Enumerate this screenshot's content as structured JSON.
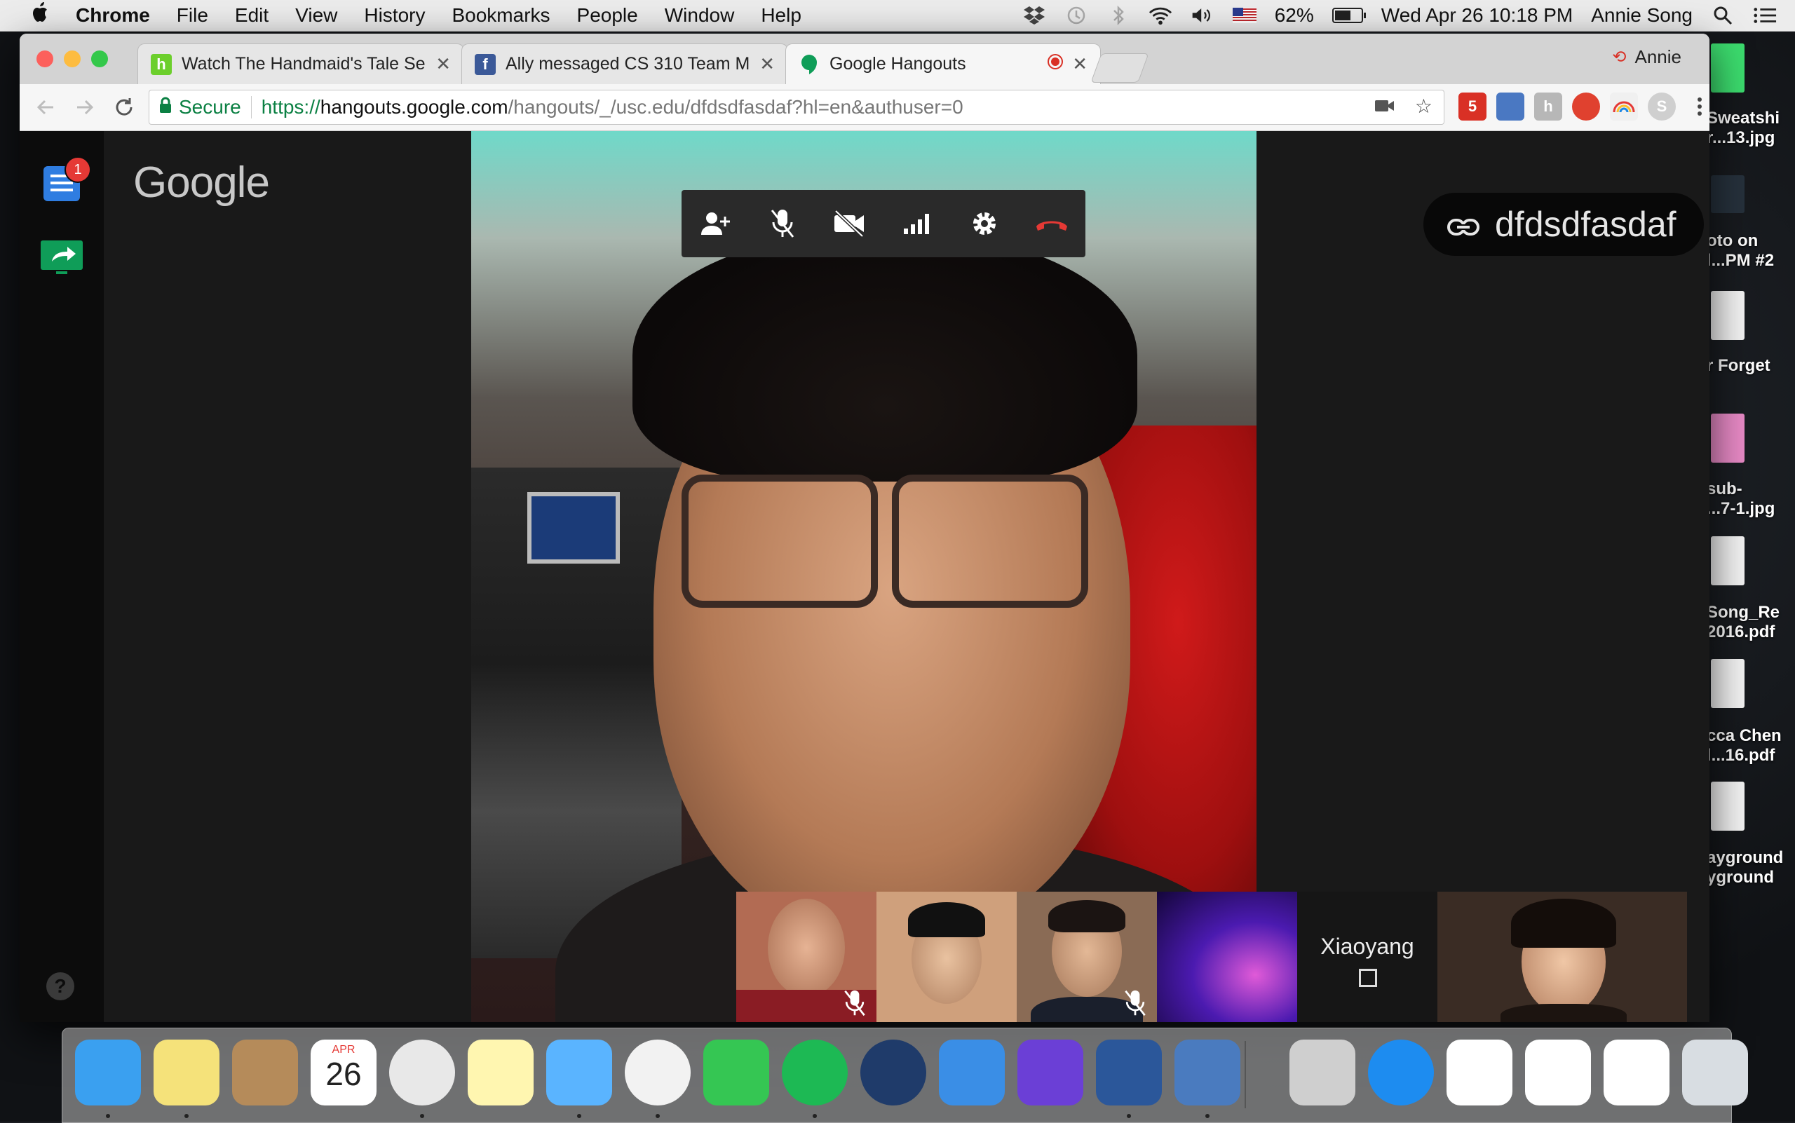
{
  "menubar": {
    "apple_label": "",
    "app_name": "Chrome",
    "menus": [
      "File",
      "Edit",
      "View",
      "History",
      "Bookmarks",
      "People",
      "Window",
      "Help"
    ],
    "battery_percent": "62%",
    "battery_level": 0.62,
    "datetime": "Wed Apr 26  10:18 PM",
    "user": "Annie Song",
    "icons": [
      "dropbox-icon",
      "time-machine-icon",
      "bluetooth-icon",
      "wifi-icon",
      "volume-icon",
      "us-flag-icon",
      "spotlight-icon",
      "notification-center-icon"
    ]
  },
  "browser": {
    "tabs": [
      {
        "title": "Watch The Handmaid's Tale Se",
        "favicon": "hulu-icon",
        "favicon_color": "#6ccf2c",
        "favicon_letter": "h",
        "active": false
      },
      {
        "title": "Ally messaged CS 310 Team M",
        "favicon": "facebook-icon",
        "favicon_color": "#3b5998",
        "favicon_letter": "f",
        "active": false
      },
      {
        "title": "Google Hangouts",
        "favicon": "hangouts-icon",
        "favicon_color": "#0f9d58",
        "favicon_letter": "",
        "active": true
      }
    ],
    "profile_name": "Annie",
    "secure_label": "Secure",
    "url_scheme": "https://",
    "url_host": "hangouts.google.com",
    "url_path": "/hangouts/_/usc.edu/dfdsdfasdaf?hl=en&authuser=0",
    "extensions": [
      {
        "name": "gmail-ext-icon",
        "color": "#d93025",
        "label": "5"
      },
      {
        "name": "download-ext-icon",
        "color": "#4a78c2",
        "label": ""
      },
      {
        "name": "ext-h-icon",
        "color": "#b7b7b7",
        "label": "h"
      },
      {
        "name": "ext-red-icon",
        "color": "#e0412f",
        "label": ""
      },
      {
        "name": "rainbow-ext-icon",
        "color": "#f0f0f0",
        "label": ""
      },
      {
        "name": "skype-ext-icon",
        "color": "#cfcfcf",
        "label": "S"
      }
    ]
  },
  "hangouts": {
    "brand": "Google",
    "notification_count": "1",
    "help_label": "?",
    "meeting_name": "dfdsdfasdaf",
    "call_controls": [
      "add-person",
      "mute-mic",
      "camera-off",
      "signal",
      "settings",
      "hang-up"
    ],
    "participants": [
      {
        "name": "",
        "muted": true,
        "tone": "#b26b53"
      },
      {
        "name": "",
        "muted": false,
        "tone": "#cfa07c"
      },
      {
        "name": "",
        "muted": true,
        "tone": "#8a6b55"
      },
      {
        "name": "",
        "muted": false,
        "tone": "#5a1bd0"
      },
      {
        "name": "Xiaoyang",
        "muted": false,
        "tone": "#161616"
      },
      {
        "name": "",
        "muted": false,
        "tone": "#3a2c24"
      }
    ]
  },
  "desktop": {
    "files": [
      {
        "label1": "Sweatshi",
        "label2": "r...13.jpg",
        "thumb_color": "#3cdc6e"
      },
      {
        "label1": "oto on",
        "label2": "l...PM #2",
        "thumb_color": "#26313c"
      },
      {
        "label1": "r Forget",
        "label2": "",
        "thumb_color": "#f4f4f4"
      },
      {
        "label1": "sub-",
        "label2": "...7-1.jpg",
        "thumb_color": "#e88ac6"
      },
      {
        "label1": "Song_Re",
        "label2": "2016.pdf",
        "thumb_color": "#f4f4f4"
      },
      {
        "label1": "cca Chen",
        "label2": "l...16.pdf",
        "thumb_color": "#f4f4f4"
      },
      {
        "label1": "ayground",
        "label2": "yground",
        "thumb_color": "#f4f4f4"
      }
    ]
  },
  "dock": {
    "calendar_month": "APR",
    "calendar_day": "26",
    "apps": [
      {
        "name": "finder-icon",
        "color": "#3aa0f0",
        "running": true
      },
      {
        "name": "stickies-icon",
        "color": "#f5e27a",
        "running": true
      },
      {
        "name": "contacts-icon",
        "color": "#b58b5a",
        "running": false
      },
      {
        "name": "calendar-icon",
        "color": "#ffffff",
        "running": false
      },
      {
        "name": "chrome-icon",
        "color": "#e8e8e8",
        "running": true
      },
      {
        "name": "notes-icon",
        "color": "#fff6b0",
        "running": false
      },
      {
        "name": "messages-icon",
        "color": "#5ab4ff",
        "running": true
      },
      {
        "name": "photos-icon",
        "color": "#f2f2f2",
        "running": true
      },
      {
        "name": "facetime-icon",
        "color": "#35c653",
        "running": false
      },
      {
        "name": "spotify-icon",
        "color": "#1db954",
        "running": true
      },
      {
        "name": "sourcetree-icon",
        "color": "#1f3b6a",
        "running": false
      },
      {
        "name": "xcode-icon",
        "color": "#3a8ee6",
        "running": false
      },
      {
        "name": "imovie-icon",
        "color": "#6b3fd6",
        "running": false
      },
      {
        "name": "word-icon",
        "color": "#2b579a",
        "running": true
      },
      {
        "name": "virtualbox-icon",
        "color": "#4a7bbf",
        "running": true
      },
      {
        "name": "photo-stack-icon",
        "color": "#cfcfcf",
        "running": false
      },
      {
        "name": "app-store-icon",
        "color": "#1d8cf0",
        "running": false
      },
      {
        "name": "doc-word-icon",
        "color": "#ffffff",
        "running": false
      },
      {
        "name": "doc-chrome-icon",
        "color": "#ffffff",
        "running": false
      },
      {
        "name": "doc-chrome2-icon",
        "color": "#ffffff",
        "running": false
      },
      {
        "name": "trash-icon",
        "color": "#d8dde2",
        "running": false
      }
    ]
  }
}
